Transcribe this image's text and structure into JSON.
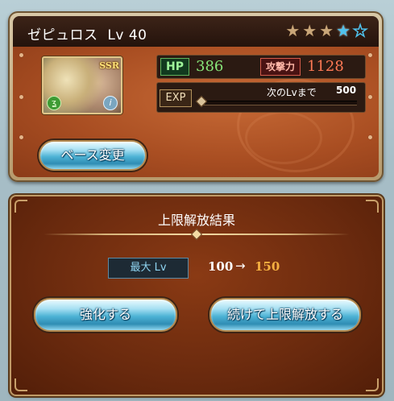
{
  "character": {
    "name": "ゼピュロス",
    "level_label": "Lv 40",
    "rarity_badge": "SSR",
    "stars_filled_bronze": 3,
    "stars_blue_filled": 1,
    "stars_blue_outline": 1
  },
  "stats": {
    "hp_label": "HP",
    "hp_value": "386",
    "atk_label": "攻撃力",
    "atk_value": "1128"
  },
  "exp": {
    "label": "EXP",
    "next_label": "次のLvまで",
    "next_value": "500",
    "progress": 0
  },
  "buttons": {
    "base_change": "ベース変更",
    "enhance": "強化する",
    "continue_uncap": "続けて上限解放する"
  },
  "result": {
    "title": "上限解放結果",
    "max_lv_label": "最大 Lv",
    "from": "100",
    "arrow": "→",
    "to": "150"
  },
  "colors": {
    "hp": "#88e67a",
    "atk": "#ff7a55",
    "level_to": "#f5b041",
    "accent_blue": "#4fc1ec"
  },
  "icons": {
    "star": "star-icon",
    "element": "wind-element-icon",
    "info": "info-icon"
  }
}
